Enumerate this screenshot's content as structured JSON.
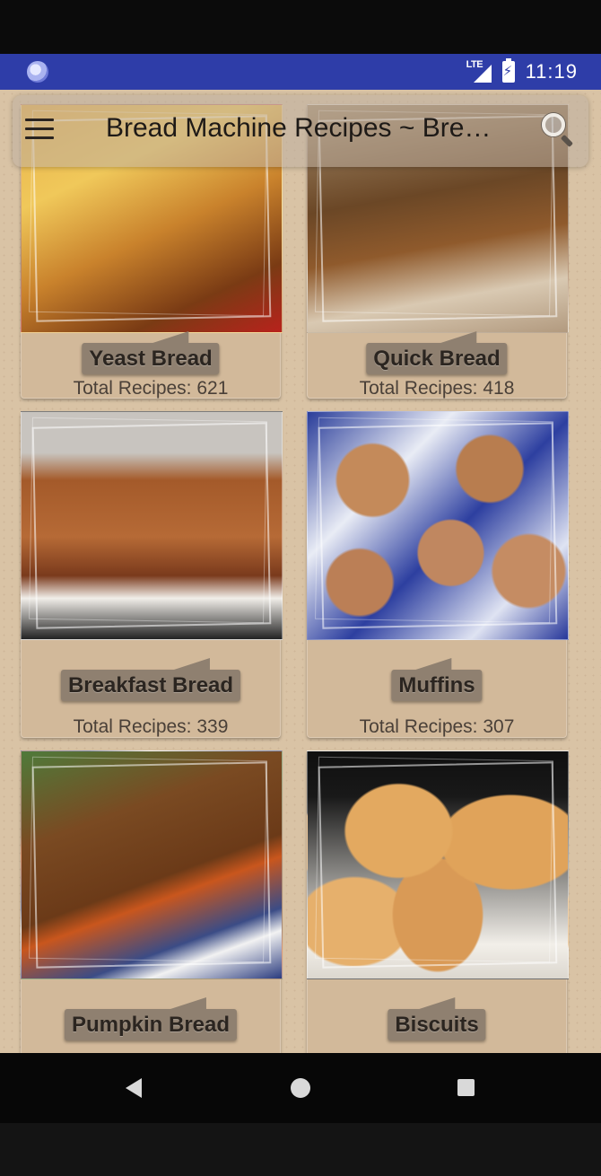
{
  "status_bar": {
    "network": "LTE",
    "time": "11:19",
    "color": "#2e3da8"
  },
  "toolbar": {
    "title": "Bread Machine Recipes ~ Bread Machine Recipes",
    "menu_icon": "hamburger-menu-icon",
    "search_icon": "search-icon"
  },
  "categories": [
    {
      "name": "Yeast Bread",
      "count": "Total Recipes: 621",
      "image": "yeast-bread-photo"
    },
    {
      "name": "Quick Bread",
      "count": "Total Recipes: 418",
      "image": "quick-bread-photo"
    },
    {
      "name": "Breakfast Bread",
      "count": "Total Recipes: 339",
      "image": "breakfast-bread-photo"
    },
    {
      "name": "Muffins",
      "count": "Total Recipes: 307",
      "image": "muffins-photo"
    },
    {
      "name": "Pumpkin Bread",
      "count": "",
      "image": "pumpkin-bread-photo"
    },
    {
      "name": "Biscuits",
      "count": "",
      "image": "biscuits-photo"
    }
  ],
  "nav_bar": {
    "back": "back-icon",
    "home": "home-icon",
    "recents": "recents-icon"
  }
}
